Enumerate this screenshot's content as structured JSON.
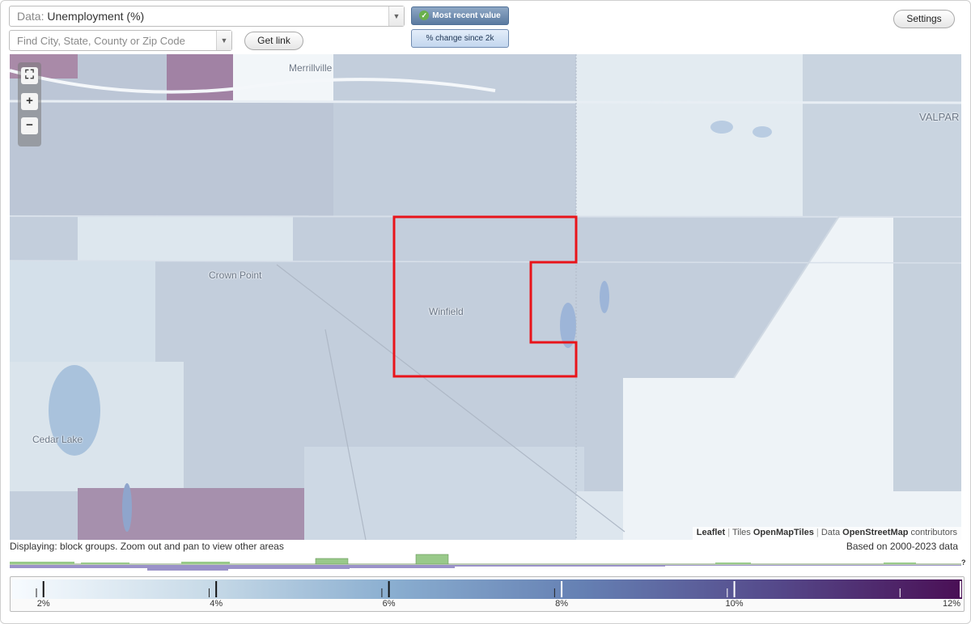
{
  "header": {
    "data_label": "Data:",
    "data_value": "Unemployment (%)",
    "search_placeholder": "Find City, State, County or Zip Code",
    "get_link": "Get link",
    "most_recent": "Most recent value",
    "change_since": "% change since 2k",
    "settings": "Settings"
  },
  "map": {
    "labels": {
      "merrillville": "Merrillville",
      "valpar": "VALPAR",
      "crown_point": "Crown Point",
      "winfield": "Winfield",
      "cedar_lake": "Cedar Lake"
    },
    "zoom_in": "+",
    "zoom_out": "−",
    "fit": "⛶",
    "attribution": {
      "leaflet": "Leaflet",
      "tiles": "Tiles",
      "openmaptiles": "OpenMapTiles",
      "data": "Data",
      "osm": "OpenStreetMap",
      "contributors": "contributors"
    },
    "highlight_color": "#e8141a"
  },
  "status": {
    "displaying": "Displaying: block groups. Zoom out and pan to view other areas",
    "based_on": "Based on 2000-2023 data"
  },
  "legend": {
    "min_value": 1,
    "max_value": 12,
    "ticks": [
      {
        "value": 2,
        "label": "2%"
      },
      {
        "value": 4,
        "label": "4%"
      },
      {
        "value": 6,
        "label": "6%"
      },
      {
        "value": 8,
        "label": "8%"
      },
      {
        "value": 10,
        "label": "10%"
      },
      {
        "value": 12,
        "label": "12%"
      }
    ],
    "unknown_mark": "?",
    "colors": [
      "#f7fbff",
      "#c9dbe8",
      "#8aaed0",
      "#6580b3",
      "#554a8b",
      "#4a0f55"
    ]
  }
}
